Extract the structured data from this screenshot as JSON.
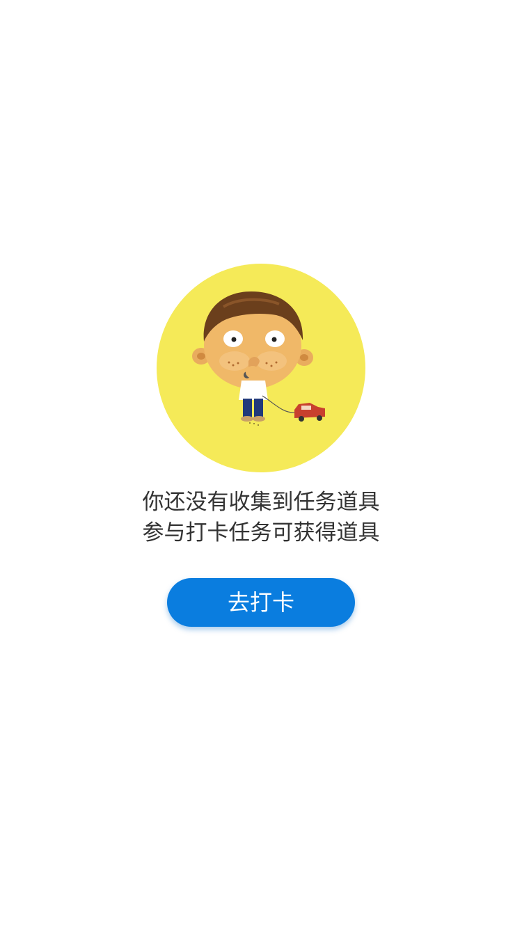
{
  "empty_state": {
    "illustration": {
      "icon": "boy-with-toy-car-icon",
      "background_color": "#f5ea58"
    },
    "message_line_1": "你还没有收集到任务道具",
    "message_line_2": "参与打卡任务可获得道具"
  },
  "cta": {
    "label": "去打卡",
    "color": "#0a7ddf"
  }
}
